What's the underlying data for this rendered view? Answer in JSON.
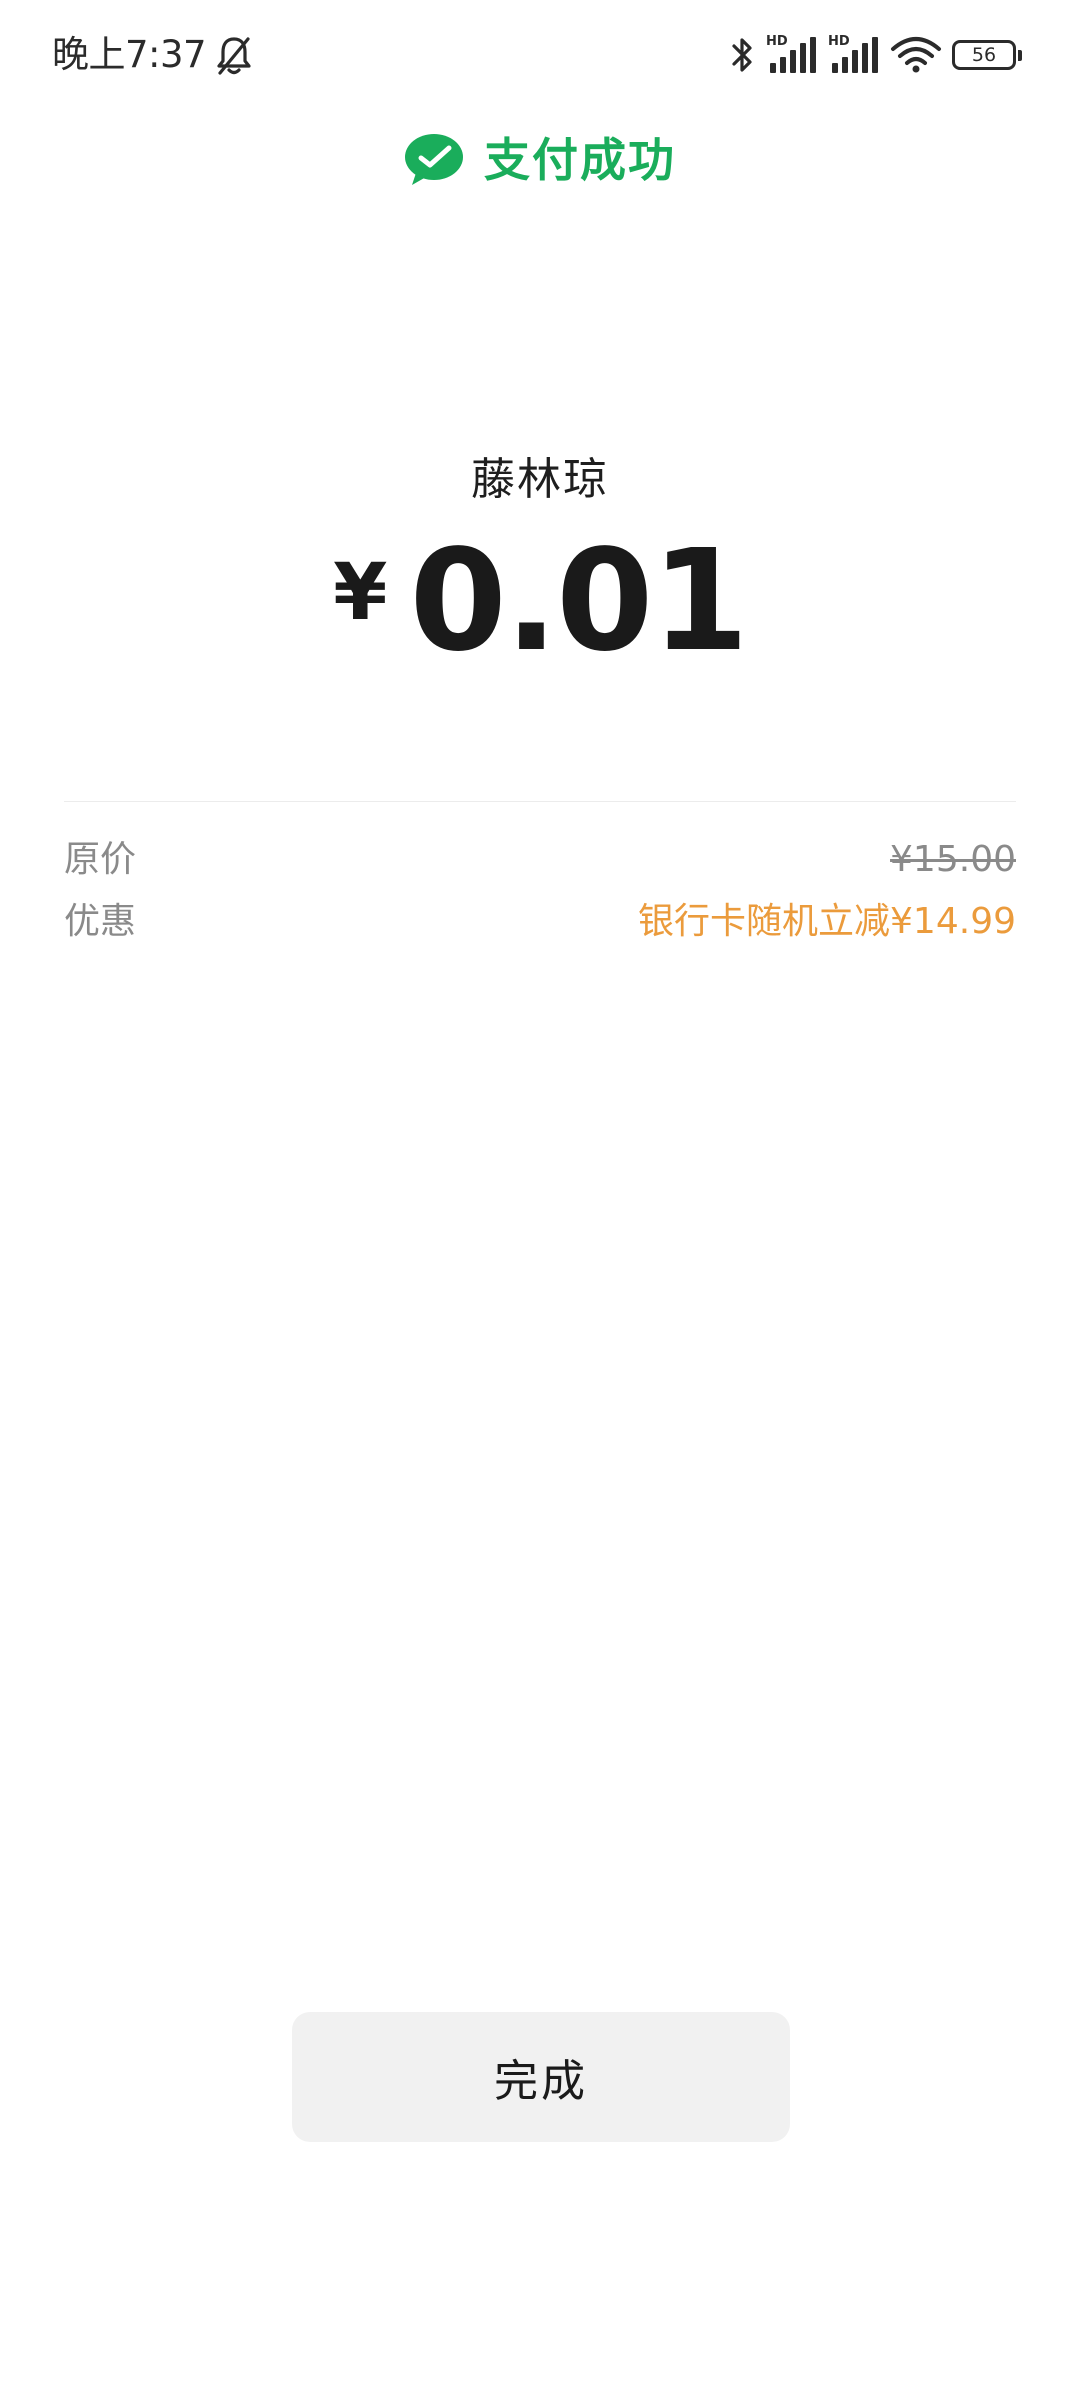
{
  "status_bar": {
    "time": "晚上7:37",
    "signal_label_1": "HD",
    "signal_label_2": "HD",
    "battery_level": "56",
    "icons": [
      "bell-muted-icon",
      "bluetooth-icon",
      "signal-icon",
      "signal-icon",
      "wifi-icon",
      "battery-icon"
    ]
  },
  "header": {
    "icon": "wechat-pay-icon",
    "title": "支付成功",
    "accent_color": "#1aad5b"
  },
  "payment": {
    "payee": "藤林琼",
    "currency_symbol": "¥",
    "amount": "0.01"
  },
  "details": {
    "original_price_label": "原价",
    "original_price_value": "¥15.00",
    "discount_label": "优惠",
    "discount_value": "银行卡随机立减¥14.99",
    "discount_color": "#eb9b3c"
  },
  "actions": {
    "done_label": "完成"
  }
}
